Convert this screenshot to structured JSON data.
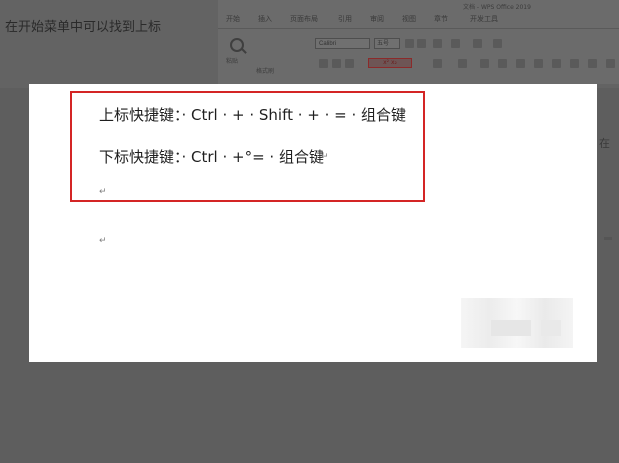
{
  "caption": "在开始菜单中可以找到上标",
  "ribbon": {
    "title": "文档 - WPS Office 2019",
    "tabs": [
      "开始",
      "插入",
      "页面布局",
      "引用",
      "审阅",
      "视图",
      "章节",
      "开发工具"
    ],
    "paste_label": "粘贴",
    "format_painter_label": "格式刷",
    "font_name": "Calibri",
    "font_size": "五号",
    "toolbar_label": "文字工具",
    "sub_sup_label": "x² x₂"
  },
  "document": {
    "lines": [
      "上标快捷键：· Ctrl · + · Shift · + · = · 组合键",
      "下标快捷键：· Ctrl · +°= · 组合键"
    ],
    "paragraph_mark": "↵"
  },
  "side_text": "在"
}
